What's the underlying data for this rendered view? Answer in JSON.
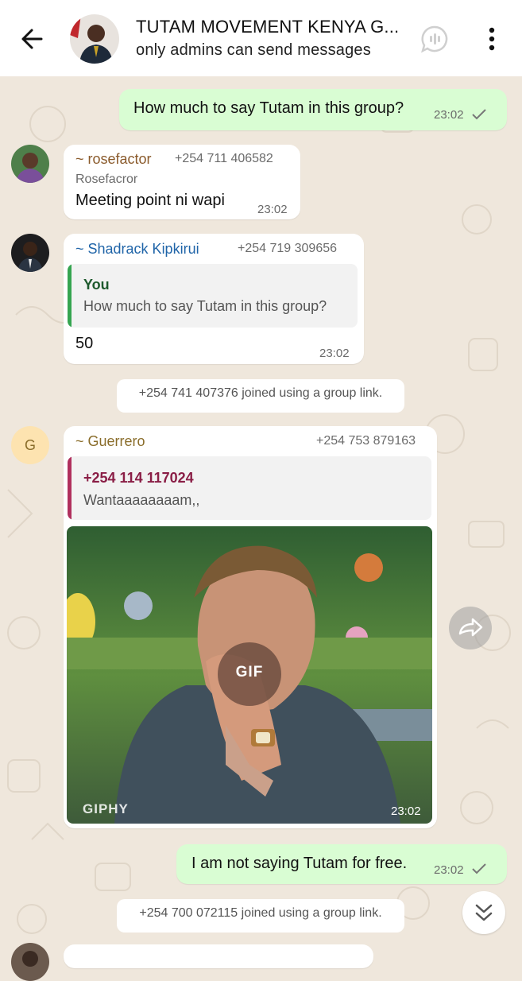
{
  "header": {
    "title": "TUTAM MOVEMENT KENYA G...",
    "subtitle": "only admins can send messages",
    "back_icon": "back-arrow-icon",
    "call_icon": "group-call-icon",
    "menu_icon": "more-vertical-icon"
  },
  "messages": [
    {
      "direction": "out",
      "text": "How much to say Tutam in this group?",
      "time": "23:02"
    },
    {
      "direction": "in",
      "sender": "~ rosefactor",
      "phone": "+254 711 406582",
      "pushname": "Rosefacror",
      "text": "Meeting point ni wapi",
      "time": "23:02"
    },
    {
      "direction": "in",
      "sender": "~ Shadrack Kipkirui",
      "phone": "+254 719 309656",
      "quote_author": "You",
      "quote_text": "How much to say Tutam in this group?",
      "text": "50",
      "time": "23:02"
    },
    {
      "direction": "in",
      "sender": "~ Guerrero",
      "avatar_letter": "G",
      "phone": "+254 753 879163",
      "quote_author": "+254 114 117024",
      "quote_text": "Wantaaaaaaaam,,",
      "gif_badge": "GIF",
      "gif_brand": "GIPHY",
      "time": "23:02"
    },
    {
      "direction": "out",
      "text": "I am not saying Tutam for free.",
      "time": "23:02"
    }
  ],
  "system_messages": [
    "+254 741 407376 joined using a group link.",
    "+254 700 072115 joined using a group link."
  ],
  "colors": {
    "outgoing_bubble": "#d9fdd3",
    "incoming_bubble": "#ffffff",
    "background": "#efe7dc",
    "sender_rosefactor": "#8a5a2b",
    "sender_shadrack": "#1f64a8",
    "sender_guerrero": "#8a6d2b",
    "quote_bar_you": "#35a550",
    "quote_bar_other": "#b0305e",
    "quote_author_other": "#8a1e46"
  }
}
